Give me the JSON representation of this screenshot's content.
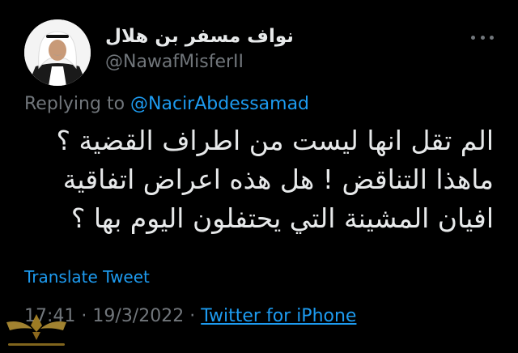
{
  "author": {
    "display_name": "نواف مسفر بن هلال",
    "handle": "@NawafMisferII"
  },
  "reply": {
    "prefix": "Replying to",
    "to_handle": "@NacirAbdessamad"
  },
  "tweet": {
    "text": "الم تقل انها ليست من اطراف القضية ؟ ماهذا التناقض ! هل هذه اعراض اتفاقية افيان المشينة التي يحتفلون اليوم بها ؟",
    "translate_label": "Translate Tweet",
    "time": "17:41",
    "separator": "·",
    "date": "19/3/2022",
    "source": "Twitter for iPhone"
  },
  "colors": {
    "background": "#000000",
    "text": "#e7e9ea",
    "secondary": "#71767b",
    "accent": "#1d9bf0"
  },
  "icons": {
    "more": "more-horizontal-icon"
  }
}
